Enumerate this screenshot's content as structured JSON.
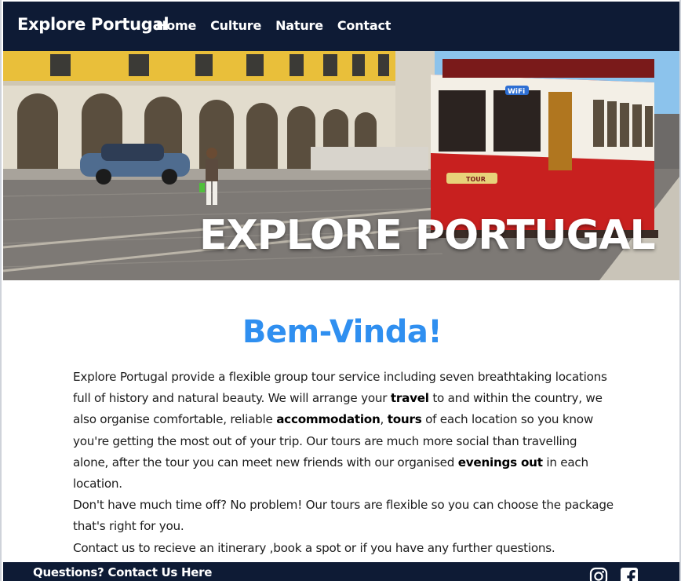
{
  "navbar": {
    "brand": "Explore Portugal",
    "links": [
      "Home",
      "Culture",
      "Nature",
      "Contact"
    ]
  },
  "hero": {
    "title": "EXPLORE PORTUGAL",
    "tram_sign": "WiFi",
    "tram_badge": "TOUR"
  },
  "welcome": {
    "heading": "Bem-Vinda!",
    "p1": {
      "t1": "Explore Portugal provide a flexible group tour service including seven breathtaking locations full of history and natural beauty. We will arrange your ",
      "b1": "travel",
      "t2": " to and within the country, we also organise comfortable, reliable ",
      "b2": "accommodation",
      "t3": ", ",
      "b3": "tours",
      "t4": " of each location so you know you're getting the most out of your trip. Our tours are much more social than travelling alone, after the tour you can meet new friends with our organised ",
      "b4": "evenings out",
      "t5": " in each location."
    },
    "p2": "Don't have much time off? No problem! Our tours are flexible so you can choose the package that's right for you.",
    "p3": "Contact us to recieve an itinerary ,book a spot or if you have any further questions."
  },
  "footer": {
    "contact_link": "Questions? Contact Us Here",
    "social_icons": [
      "instagram-icon",
      "facebook-icon"
    ]
  },
  "colors": {
    "navbar_bg": "#0e1b35",
    "heading_blue": "#2f8ff0",
    "tram_red": "#c8201f"
  }
}
